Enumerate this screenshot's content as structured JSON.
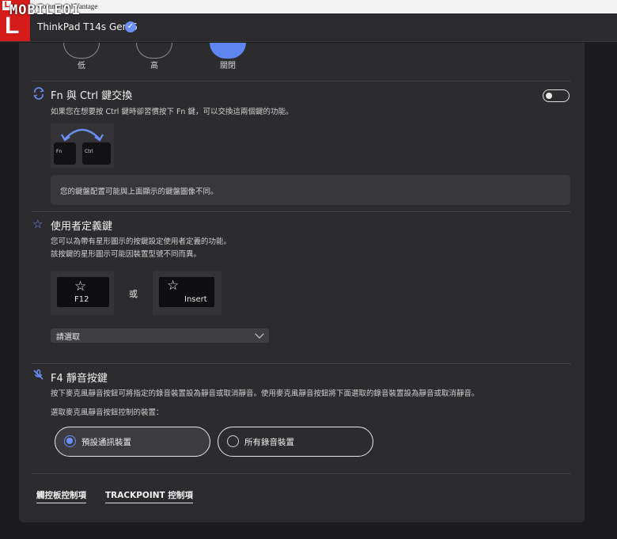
{
  "window": {
    "title": "Lenovo Commercial Vantage"
  },
  "watermark": {
    "small_letter": "L",
    "big_letter": "L",
    "wordmark": "MOBILE01"
  },
  "header": {
    "device_name": "ThinkPad T14s Gen 6"
  },
  "levels": [
    {
      "label": "低",
      "active": false
    },
    {
      "label": "高",
      "active": false
    },
    {
      "label": "關閉",
      "active": true
    }
  ],
  "fn_ctrl": {
    "title": "Fn 與 Ctrl 鍵交換",
    "description": "如果您在想要按 Ctrl 鍵時卻習慣按下 Fn 鍵，可以交換這兩個鍵的功能。",
    "toggle_on": false,
    "key_fn": "Fn",
    "key_ctrl": "Ctrl",
    "note": "您的鍵盤配置可能與上面顯示的鍵盤圖像不同。"
  },
  "user_key": {
    "title": "使用者定義鍵",
    "description_1": "您可以為帶有星形圖示的按鍵設定使用者定義的功能。",
    "description_2": "該按鍵的星形圖示可能因裝置型號不同而異。",
    "key_1": "F12",
    "or_label": "或",
    "key_2": "Insert",
    "select_value": "請選取"
  },
  "f4_mute": {
    "title": "F4 靜音按鍵",
    "description": "按下麥克風靜音按鈕可將指定的錄音裝置設為靜音或取消靜音。使用麥克風靜音按鈕將下面選取的錄音裝置設為靜音或取消靜音。",
    "choose_label": "選取麥克風靜音按鈕控制的裝置：",
    "options": [
      {
        "label": "預設通訊裝置",
        "selected": true
      },
      {
        "label": "所有錄音裝置",
        "selected": false
      }
    ]
  },
  "links": {
    "touchpad": "觸控板控制項",
    "trackpoint": "TRACKPOINT 控制項"
  },
  "colors": {
    "accent": "#6b8ff7",
    "panel": "#2c2c2f",
    "background": "#1c1c1e"
  }
}
